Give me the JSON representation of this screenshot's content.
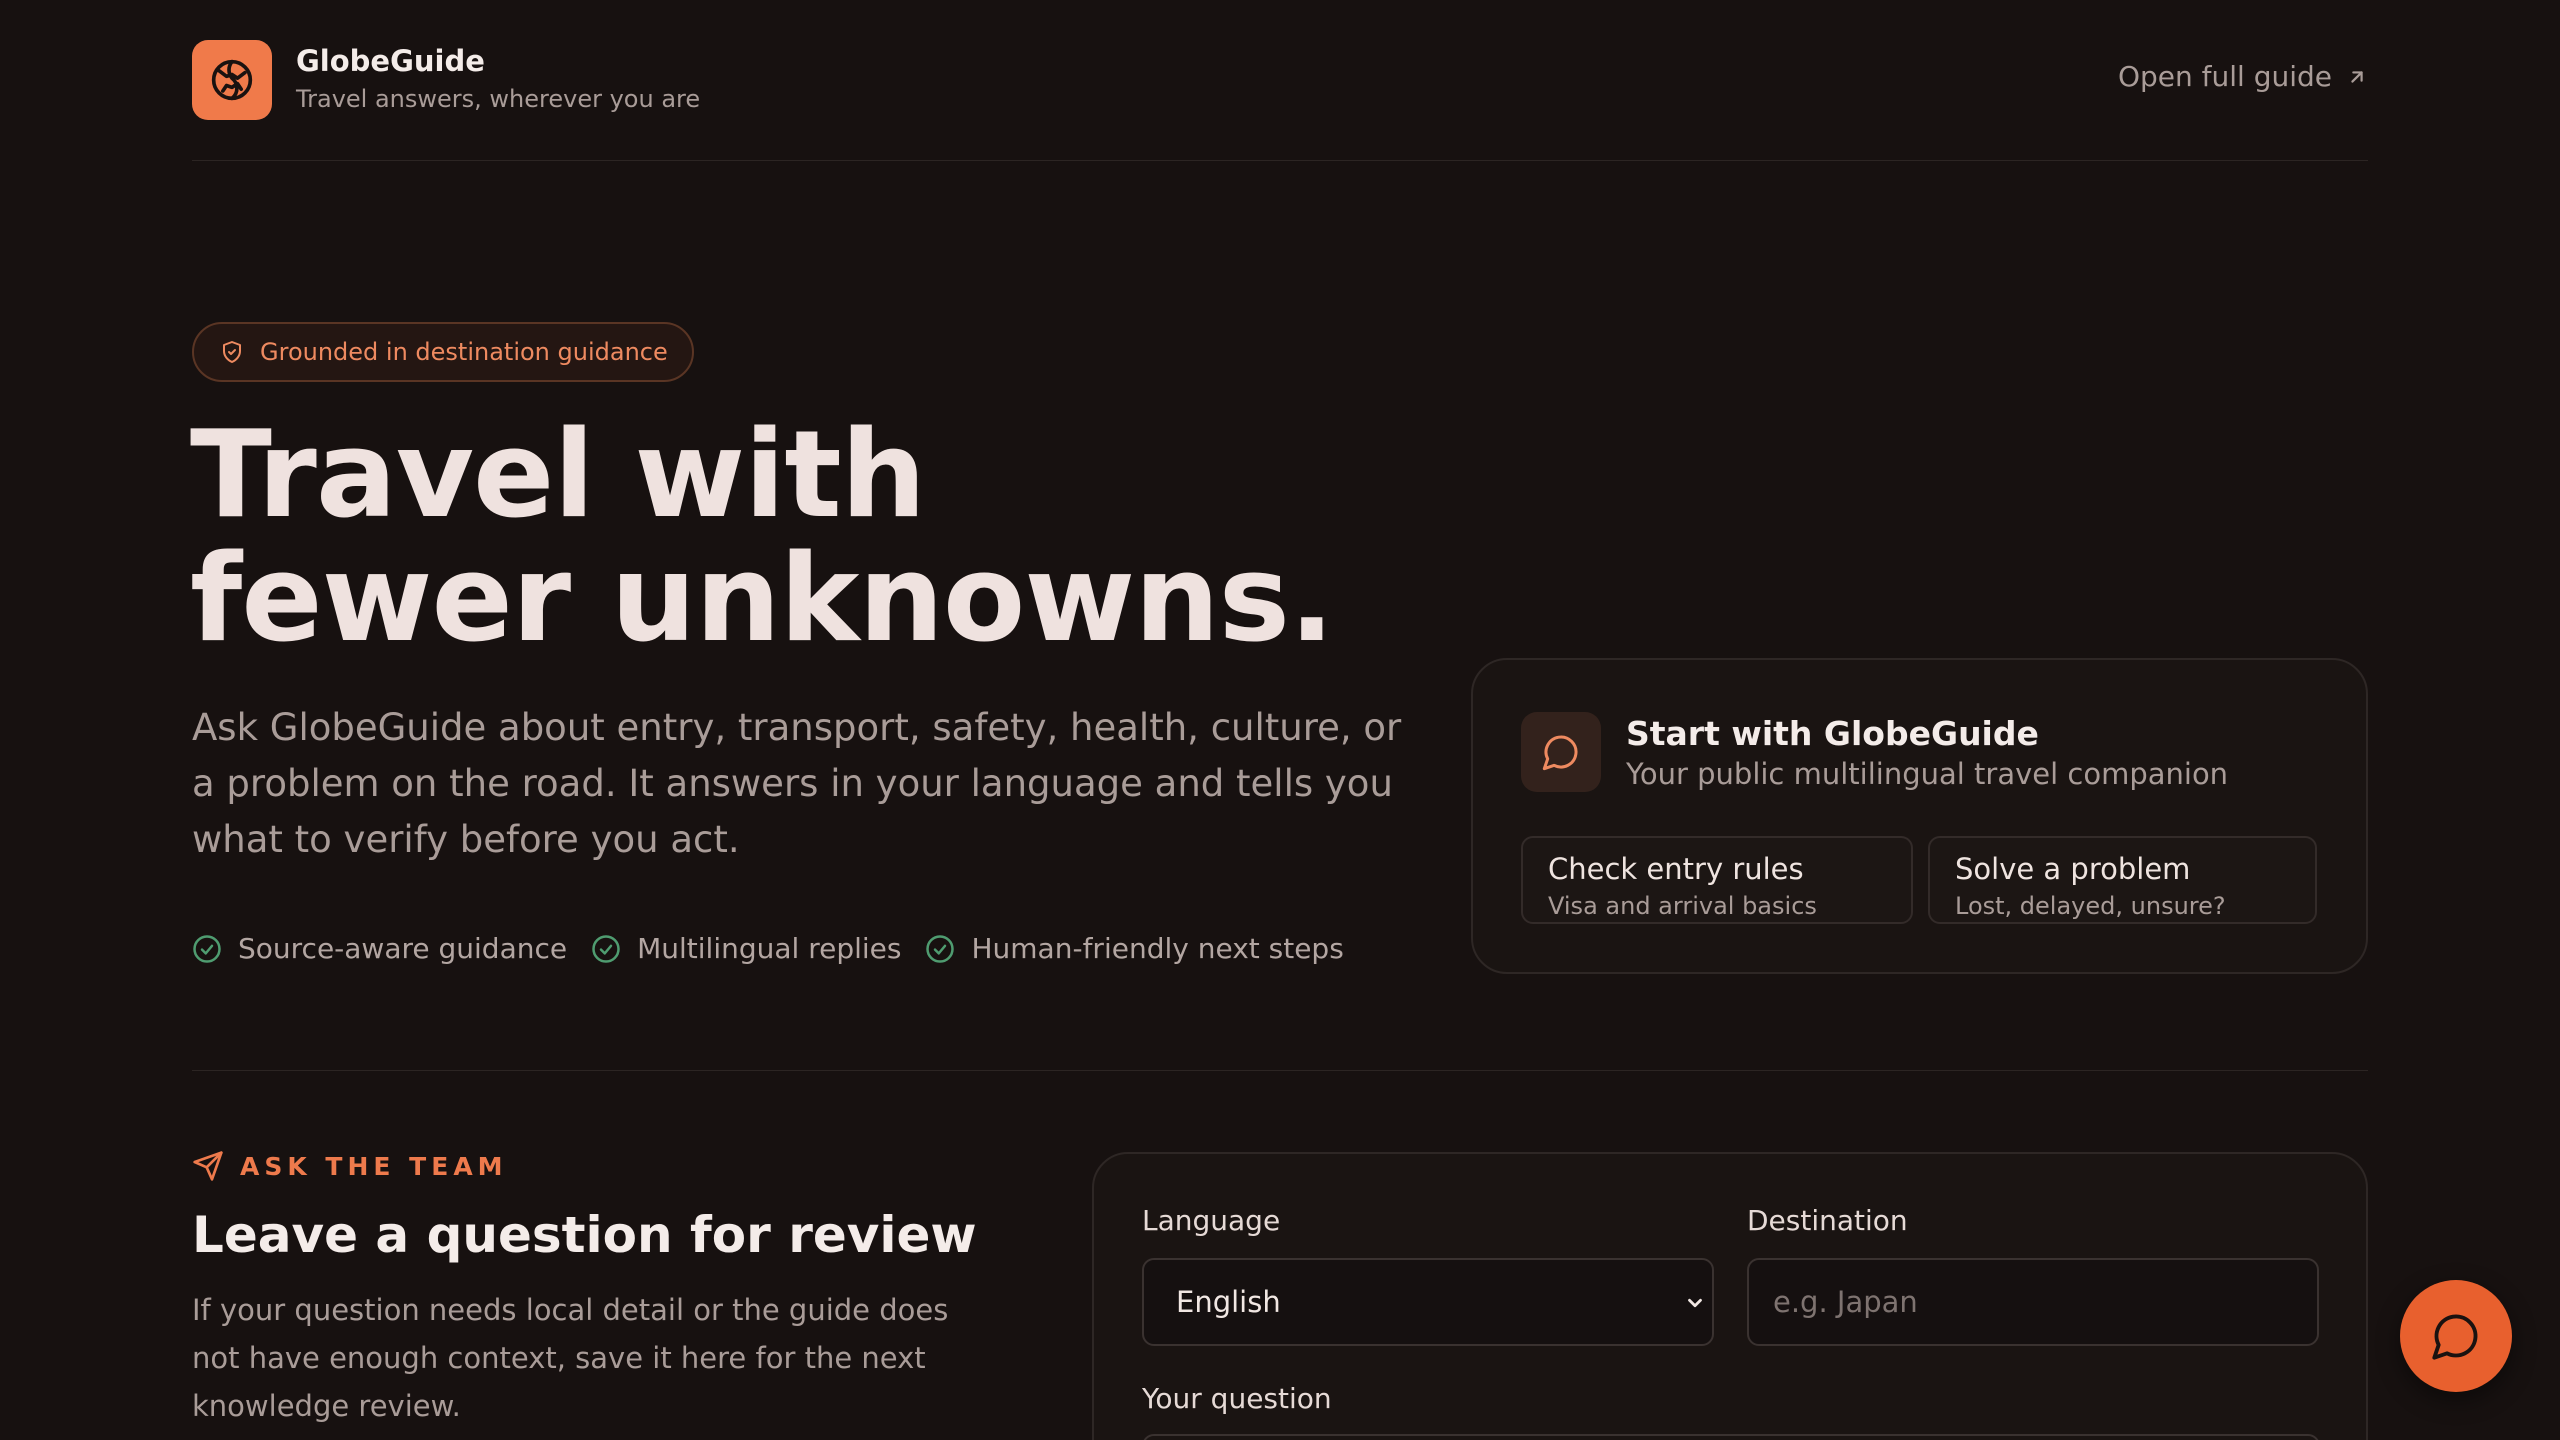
{
  "header": {
    "brand_name": "GlobeGuide",
    "tagline": "Travel answers, wherever you are",
    "open_guide_label": "Open full guide",
    "logo_icon": "globe-icon",
    "accent": "#f07a4a"
  },
  "hero": {
    "badge_label": "Grounded in destination guidance",
    "title_line1": "Travel with",
    "title_line2": "fewer unknowns.",
    "subtitle": "Ask GlobeGuide about entry, transport, safety, health, culture, or a problem on the road. It answers in your language and tells you what to verify before you act.",
    "features": [
      "Source-aware guidance",
      "Multilingual replies",
      "Human-friendly next steps"
    ]
  },
  "start_card": {
    "title": "Start with GlobeGuide",
    "subtitle": "Your public multilingual travel companion",
    "actions": [
      {
        "title": "Check entry rules",
        "subtitle": "Visa and arrival basics"
      },
      {
        "title": "Solve a problem",
        "subtitle": "Lost, delayed, unsure?"
      }
    ]
  },
  "ask": {
    "eyebrow": "ASK THE TEAM",
    "title": "Leave a question for review",
    "description": "If your question needs local detail or the guide does not have enough context, save it here for the next knowledge review."
  },
  "form": {
    "language_label": "Language",
    "language_value": "English",
    "destination_label": "Destination",
    "destination_placeholder": "e.g. Japan",
    "question_label": "Your question"
  }
}
